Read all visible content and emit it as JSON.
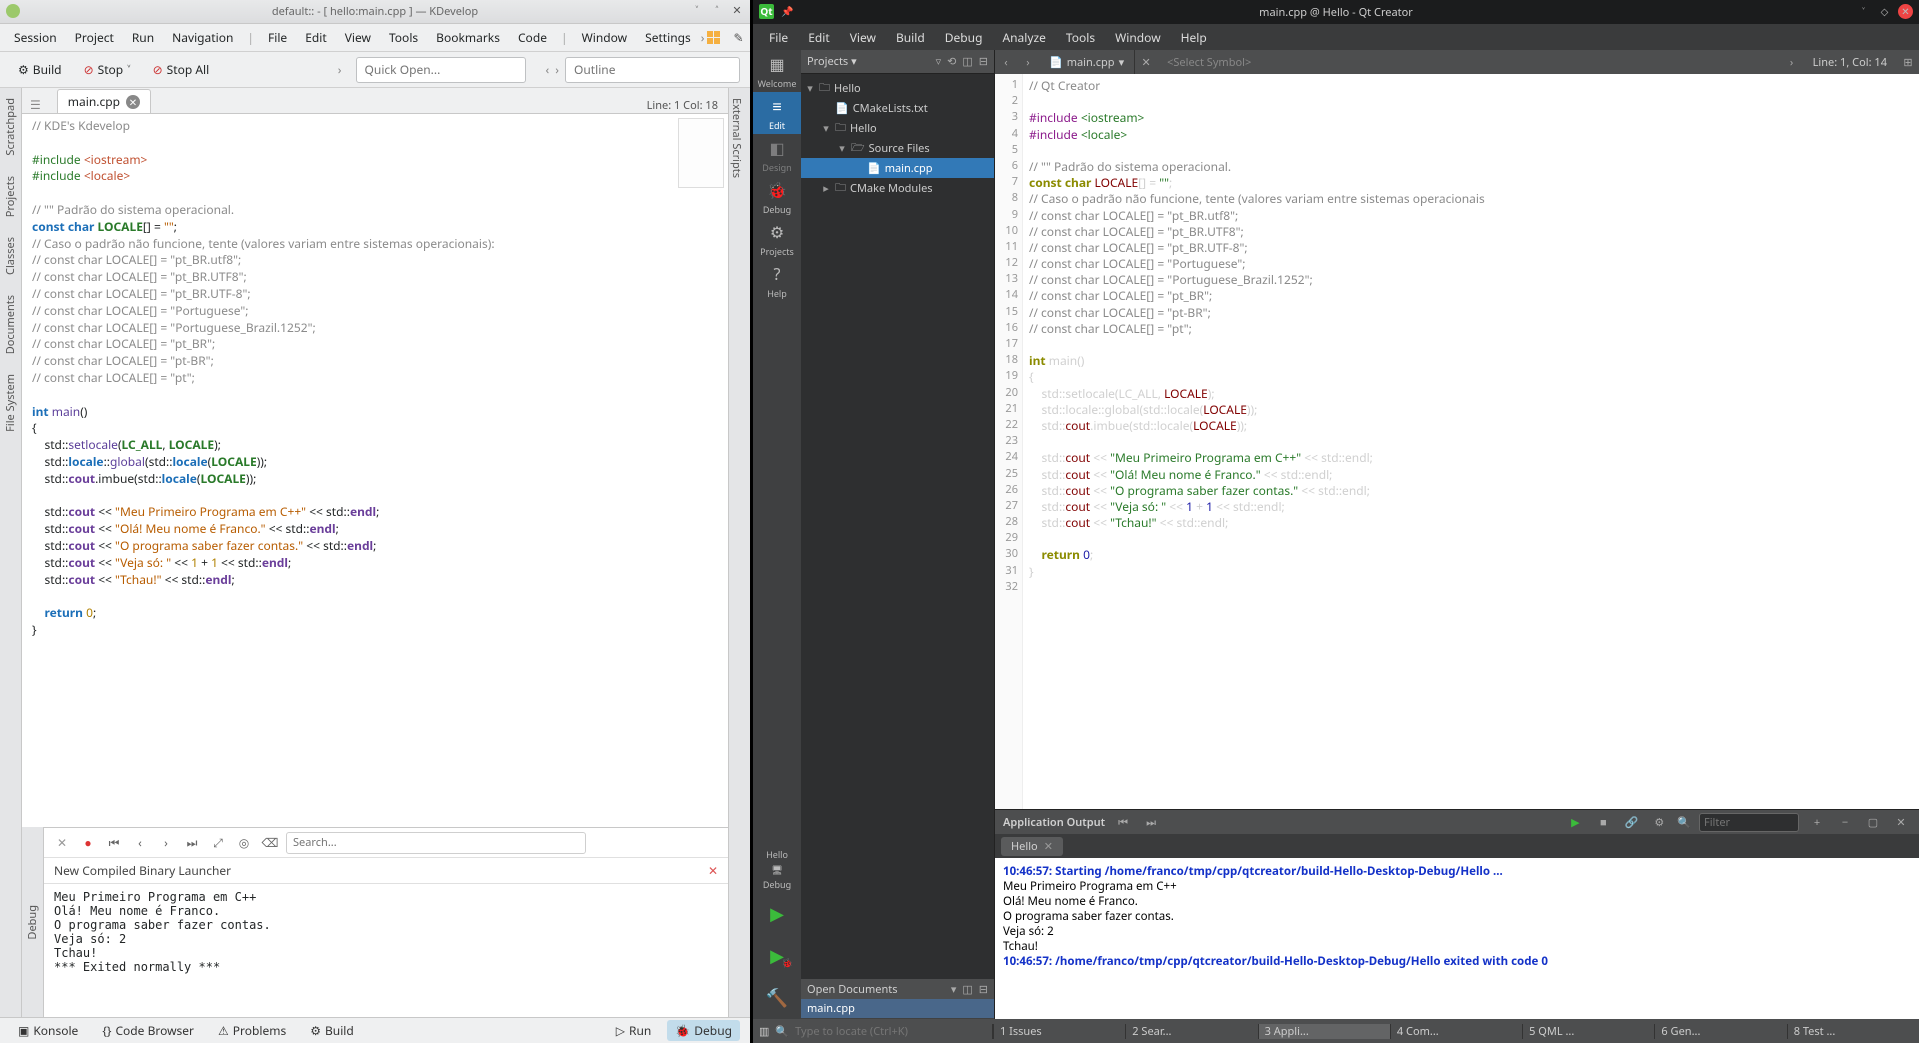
{
  "kdev": {
    "title": "default:: - [ hello:main.cpp ] — KDevelop",
    "menu": [
      "Session",
      "Project",
      "Run",
      "Navigation",
      "|",
      "File",
      "Edit",
      "View",
      "Tools",
      "Bookmarks",
      "Code",
      "|",
      "Window",
      "Settings"
    ],
    "menu_code_right": "Code",
    "toolbar": {
      "build": "Build",
      "stop": "Stop",
      "stopall": "Stop All",
      "quickopen_ph": "Quick Open...",
      "outline_ph": "Outline"
    },
    "leftrail": [
      "Scratchpad",
      "Projects",
      "Classes",
      "Documents",
      "File System"
    ],
    "rightrail": "External Scripts",
    "tab": "main.cpp",
    "cursor": "Line: 1 Col: 18",
    "code": {
      "l1": "// KDE's Kdevelop",
      "inc_io": "#include ",
      "inc_io_v": "<iostream>",
      "inc_loc": "#include ",
      "inc_loc_v": "<locale>",
      "c1": "// \"\" Padrão do sistema operacional.",
      "const": "const char ",
      "const_id": "LOCALE",
      "const_rest": "[] = ",
      "const_val": "\"\"",
      "semi": ";",
      "c2": "// Caso o padrão não funcione, tente (valores variam entre sistemas operacionais):",
      "c3": "// const char LOCALE[] = \"pt_BR.utf8\";",
      "c4": "// const char LOCALE[] = \"pt_BR.UTF8\";",
      "c5": "// const char LOCALE[] = \"pt_BR.UTF-8\";",
      "c6": "// const char LOCALE[] = \"Portuguese\";",
      "c7": "// const char LOCALE[] = \"Portuguese_Brazil.1252\";",
      "c8": "// const char LOCALE[] = \"pt_BR\";",
      "c9": "// const char LOCALE[] = \"pt-BR\";",
      "c10": "// const char LOCALE[] = \"pt\";",
      "main_sig": "int main()",
      "b1": "    std::setlocale(LC_ALL, LOCALE);",
      "b2": "    std::locale::global(std::locale(LOCALE));",
      "b3": "    std::cout.imbue(std::locale(LOCALE));",
      "p1": "    std::cout << \"Meu Primeiro Programa em C++\" << std::endl;",
      "p2": "    std::cout << \"Olá! Meu nome é Franco.\" << std::endl;",
      "p3": "    std::cout << \"O programa saber fazer contas.\" << std::endl;",
      "p4": "    std::cout << \"Veja só: \" << 1 + 1 << std::endl;",
      "p5": "    std::cout << \"Tchau!\" << std::endl;",
      "ret": "    return 0;"
    },
    "bottom": {
      "search_ph": "Search...",
      "launcher": "New Compiled Binary Launcher",
      "output": "Meu Primeiro Programa em C++\nOlá! Meu nome é Franco.\nO programa saber fazer contas.\nVeja só: 2\nTchau!\n*** Exited normally ***"
    },
    "debug_label": "Debug",
    "statusbar": {
      "konsole": "Konsole",
      "codebr": "Code Browser",
      "problems": "Problems",
      "build": "Build",
      "run": "Run",
      "debug": "Debug"
    }
  },
  "qtc": {
    "title": "main.cpp @ Hello - Qt Creator",
    "menu": [
      "File",
      "Edit",
      "View",
      "Build",
      "Debug",
      "Analyze",
      "Tools",
      "Window",
      "Help"
    ],
    "modes": [
      {
        "label": "Welcome",
        "icon": "▦"
      },
      {
        "label": "Edit",
        "icon": "≡"
      },
      {
        "label": "Design",
        "icon": "◧"
      },
      {
        "label": "Debug",
        "icon": "🐞"
      },
      {
        "label": "Projects",
        "icon": "⚙"
      },
      {
        "label": "Help",
        "icon": "?"
      }
    ],
    "kit": {
      "name": "Hello",
      "conf": "Debug"
    },
    "projects_hdr": "Projects",
    "tree": {
      "hello": "Hello",
      "cmake": "CMakeLists.txt",
      "hello2": "Hello",
      "sources": "Source Files",
      "main": "main.cpp",
      "cmakemod": "CMake Modules"
    },
    "opendocs_hdr": "Open Documents",
    "opendoc": "main.cpp",
    "tabbar": {
      "file": "main.cpp",
      "symbol": "<Select Symbol>",
      "pos": "Line: 1, Col: 14"
    },
    "code_lines": 32,
    "code": {
      "l1": "// Qt Creator",
      "inc1": "#include <iostream>",
      "inc2": "#include <locale>",
      "c1": "// \"\" Padrão do sistema operacional.",
      "const": "const char LOCALE[] = \"\";",
      "c2": "// Caso o padrão não funcione, tente (valores variam entre sistemas operacionais",
      "c3": "// const char LOCALE[] = \"pt_BR.utf8\";",
      "c4": "// const char LOCALE[] = \"pt_BR.UTF8\";",
      "c5": "// const char LOCALE[] = \"pt_BR.UTF-8\";",
      "c6": "// const char LOCALE[] = \"Portuguese\";",
      "c7": "// const char LOCALE[] = \"Portuguese_Brazil.1252\";",
      "c8": "// const char LOCALE[] = \"pt_BR\";",
      "c9": "// const char LOCALE[] = \"pt-BR\";",
      "c10": "// const char LOCALE[] = \"pt\";",
      "main": "int main()",
      "b1": "    std::setlocale(LC_ALL, LOCALE);",
      "b2": "    std::locale::global(std::locale(LOCALE));",
      "b3": "    std::cout.imbue(std::locale(LOCALE));",
      "p1": "    std::cout << \"Meu Primeiro Programa em C++\" << std::endl;",
      "p2": "    std::cout << \"Olá! Meu nome é Franco.\" << std::endl;",
      "p3": "    std::cout << \"O programa saber fazer contas.\" << std::endl;",
      "p4": "    std::cout << \"Veja só: \" << 1 + 1 << std::endl;",
      "p5": "    std::cout << \"Tchau!\" << std::endl;",
      "ret": "    return 0;"
    },
    "output": {
      "title": "Application Output",
      "filter_ph": "Filter",
      "tab": "Hello",
      "start": "10:46:57: Starting /home/franco/tmp/cpp/qtcreator/build-Hello-Desktop-Debug/Hello ...",
      "body": "Meu Primeiro Programa em C++\nOlá! Meu nome é Franco.\nO programa saber fazer contas.\nVeja só: 2\nTchau!",
      "end": "10:46:57: /home/franco/tmp/cpp/qtcreator/build-Hello-Desktop-Debug/Hello exited with code 0"
    },
    "locator_ph": "Type to locate (Ctrl+K)",
    "panes": [
      "1  Issues",
      "2  Sear...",
      "3  Appli...",
      "4  Com...",
      "5  QML ...",
      "6  Gen...",
      "8  Test ..."
    ]
  }
}
